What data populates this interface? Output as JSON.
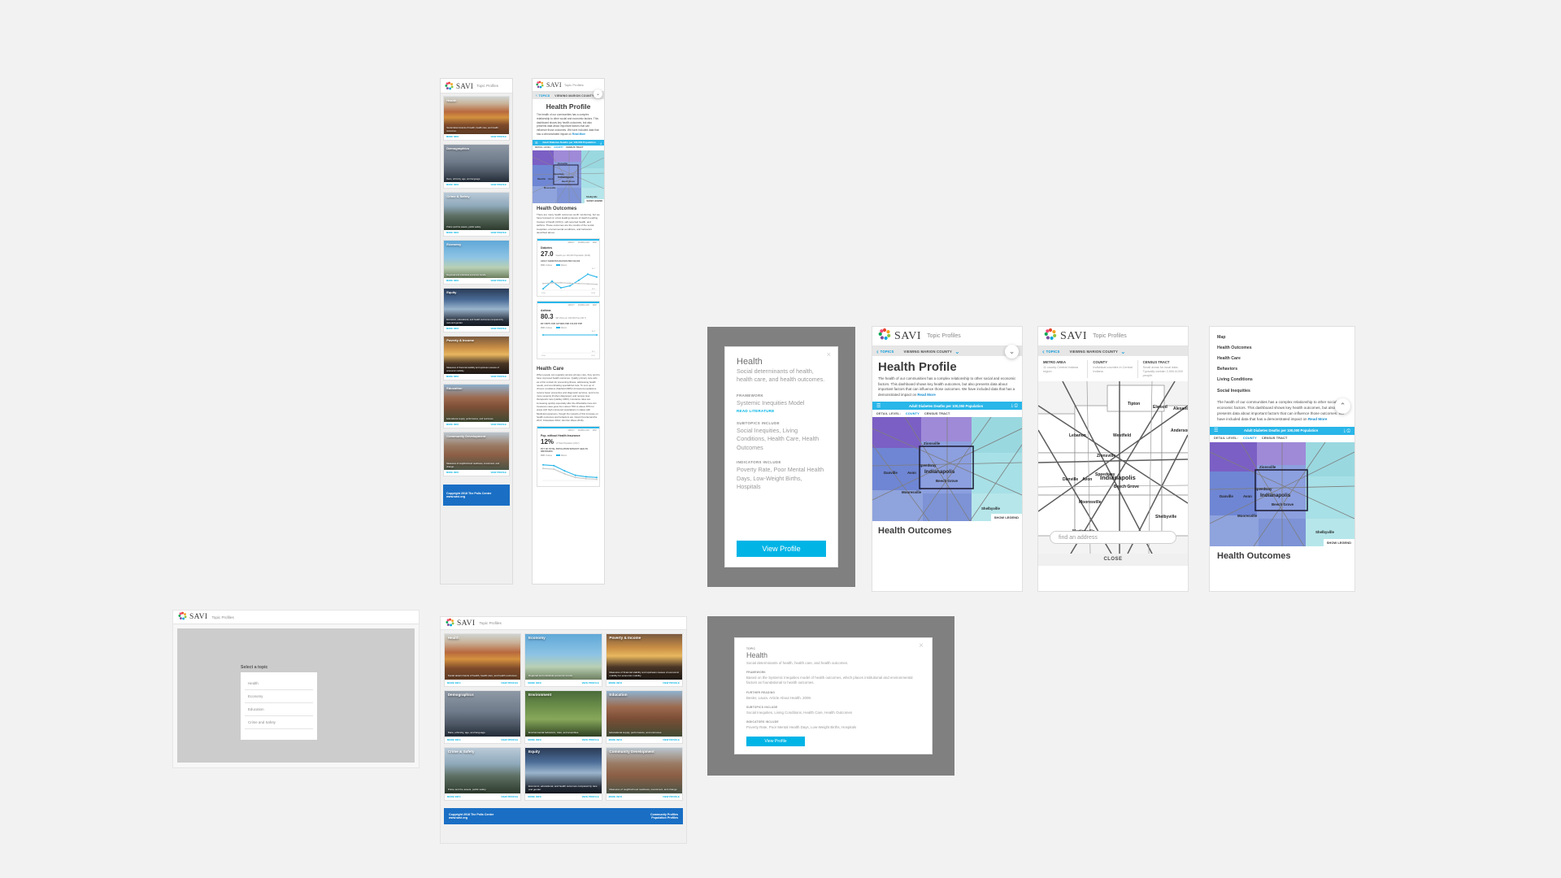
{
  "brand": {
    "name": "SAVI",
    "subtitle": "Topic Profiles"
  },
  "topics": [
    {
      "id": "health",
      "title": "Health",
      "desc": "Social determinants of health, health care, and health outcomes.",
      "photo": "ph-health"
    },
    {
      "id": "economy",
      "title": "Economy",
      "desc": "Regional and individual economic trends.",
      "photo": "ph-econ"
    },
    {
      "id": "poverty",
      "title": "Poverty & Income",
      "desc": "Measures of financial stability and upstream causes of economic mobility for economic mobility.",
      "photo": "ph-poverty"
    },
    {
      "id": "demographics",
      "title": "Demographics",
      "desc": "Race, ethnicity, age, and language.",
      "photo": "ph-demog"
    },
    {
      "id": "environment",
      "title": "Environment",
      "desc": "Environmental behaviors, risks, and amenities.",
      "photo": "ph-env"
    },
    {
      "id": "education",
      "title": "Education",
      "desc": "Educational supply, performance, and outcomes.",
      "photo": "ph-education"
    },
    {
      "id": "crime",
      "title": "Crime & Safety",
      "desc": "Police and fire assets, public safety.",
      "photo": "ph-crime"
    },
    {
      "id": "equity",
      "title": "Equity",
      "desc": "Economic, educational, and health outcomes compared by race and gender.",
      "photo": "ph-equity"
    },
    {
      "id": "commdev",
      "title": "Community Development",
      "desc": "Measures of neighborhood readiness, investment, and change.",
      "photo": "ph-commdev"
    }
  ],
  "mobile_topics": [
    {
      "title": "Health",
      "desc": "Social determinants of health, health care, and health outcomes.",
      "photo": "ph-health"
    },
    {
      "title": "Demographics",
      "desc": "Race, ethnicity, age, and language.",
      "photo": "ph-demog"
    },
    {
      "title": "Crime & Safety",
      "desc": "Police and fire assets, public safety.",
      "photo": "ph-crime"
    },
    {
      "title": "Economy",
      "desc": "Regional and individual economic trends.",
      "photo": "ph-econ"
    },
    {
      "title": "Equity",
      "desc": "Economic, educational, and health outcomes compared by race and gender.",
      "photo": "ph-equity"
    },
    {
      "title": "Poverty & Income",
      "desc": "Measures of financial stability and upstream causes of economic mobility.",
      "photo": "ph-poverty"
    },
    {
      "title": "Education",
      "desc": "Educational supply, performance, and outcomes.",
      "photo": "ph-education"
    },
    {
      "title": "Community Development",
      "desc": "Measures of neighborhood readiness, investment, and change.",
      "photo": "ph-commdev"
    }
  ],
  "card_actions": {
    "more_info": "MORE INFO",
    "view_profile": "VIEW PROFILE"
  },
  "footer": {
    "copyright": "Copyright 2018 The Polis Center",
    "url": "www.savi.org",
    "link_a": "Community Profiles",
    "link_b": "Population Profiles"
  },
  "select_topic": {
    "heading": "Select a topic",
    "options": [
      "Health",
      "Economy",
      "Education",
      "Crime and Safety"
    ]
  },
  "modal_tablet": {
    "title": "Health",
    "desc": "Social determinants of health, health care, and health outcomes.",
    "framework_label": "FRAMEWORK",
    "framework_value": "Systemic Inequities Model",
    "read_literature": "READ LITERATURE",
    "subtopics_label": "SUBTOPICS INCLUDE",
    "subtopics_value": "Social Inequities, Living Conditions, Health Care, Health Outcomes",
    "indicators_label": "INDICATORS INCLUDE",
    "indicators_value": "Poverty Rate, Poor Mental Health Days, Low-Weight Births, Hospitals",
    "button": "View Profile",
    "close": "×"
  },
  "modal_desktop": {
    "topic_label": "TOPIC",
    "title": "Health",
    "desc": "Social determinants of health, health care, and health outcomes.",
    "framework_label": "FRAMEWORK",
    "framework_value": "Based on the Systemic Inequities model of health outcomes, which places institutional and environmental factors as foundational to health outcomes.",
    "reading_label": "FURTHER READING",
    "reading_value": "Besler, Laura. Article About Health. 2009.",
    "subtopics_label": "SUBTOPICS INCLUDE",
    "subtopics_value": "Social Inequities, Living Conditions, Health Care, Health Outcomes",
    "indicators_label": "INDICATORS INCLUDE",
    "indicators_value": "Poverty Rate, Poor Mental Health Days, Low-Weight Births, Hospitals",
    "button": "View Profile",
    "close": "×"
  },
  "profile": {
    "back": "TOPICS",
    "viewing": "VIEWING MARION COUNTY",
    "title": "Health Profile",
    "intro": "The health of our communities has a complex relationship to other social and economic factors. This dashboard shows key health outcomes, but also presents data about important factors that can influence those outcomes. We have included data that has a demonstrated impact on",
    "read_more": "Read More",
    "map_title": "Adult Diabetes Deaths per 100,000 Population",
    "detail_label": "DETAIL LEVEL:",
    "detail_county": "COUNTY",
    "detail_tract": "CENSUS TRACT",
    "show_legend": "SHOW LEGEND",
    "section_outcomes": "Health Outcomes",
    "outcomes_body": "There are many health outcomes worth monitoring, but we have focused on a few leading causes of death (Leading Causes of Death (CDC)), self-reported health, and asthma. These outcomes are the results of the social inequities, environmental conditions, and behaviors described above.",
    "section_care": "Health Care",
    "care_body": "When people can regularly access primary care, they tend to have improved health outcomes. Quality primary care acts as a first contact for preventing illness, addressing health needs, and coordinating specialized care. To sum up of chronic conditions (Starfield 2005) Uninsured populations receive fewer preventive and diagnostic services, tend to be more severely ill when diagnosed, and receive less therapeutic care (Hadley 2003). Insurance rates are increasing quickly especially after the Affordable Care Act. Insurance rates grew from about 79% to above 87% for areas with high uninsured populations in states with Medicaid expansion, though the impacts of this increase on health outcomes and behaviors are mixed (Courtemanche 2017; Finkelstein 2012; Van Der Wees 2016)."
  },
  "nav_sections": [
    "Map",
    "Health Outcomes",
    "Health Care",
    "Behaviors",
    "Living Conditions",
    "Social Inequities"
  ],
  "detail_levels": [
    {
      "name": "METRO AREA",
      "desc": "11 county Central Indiana region"
    },
    {
      "name": "COUNTY",
      "desc": "Individual counties in Central Indiana"
    },
    {
      "name": "CENSUS TRACT",
      "desc": "Small areas for local data. Typically contain 2,500-8,000 people."
    }
  ],
  "address_search": {
    "placeholder": "find an address",
    "close": "CLOSE"
  },
  "indicator_tabs": [
    "ABOUT",
    "DOWNLOAD",
    "MAP"
  ],
  "chart_data": [
    {
      "type": "line",
      "id": "diabetes",
      "title": "Diabetes",
      "value": "27.0",
      "unit": "Deaths per 100,000 Population (2016)",
      "caption": "ADULT DIABETES DEATHS PER 100,000",
      "legend": [
        "Indiana",
        "Marion"
      ],
      "x": [
        "2010",
        "2011",
        "2012",
        "2013",
        "2014",
        "2015",
        "2016"
      ],
      "ylim": [
        18.1,
        33.7
      ],
      "ytick_top": "33.7",
      "ytick_bottom": "18.1",
      "xtick_left": "2010",
      "xtick_right": "2016",
      "series": [
        {
          "name": "Marion",
          "color": "#29b6e8",
          "values": [
            19.4,
            26.0,
            20.2,
            21.9,
            26.8,
            32.1,
            29.6
          ]
        },
        {
          "name": "Indiana",
          "color": "#c9c9c9",
          "values": [
            24.0,
            24.4,
            24.6,
            24.2,
            23.9,
            23.6,
            23.3
          ]
        }
      ]
    },
    {
      "type": "line",
      "id": "asthma",
      "title": "Asthma",
      "value": "80.3",
      "unit": "ER Visits per 100,000 Pop (2017)",
      "caption": "ER VISITS FOR ASTHMA PER 100,000 POP",
      "legend": [
        "Indiana",
        "Marion"
      ],
      "x": [
        "2016",
        "2017"
      ],
      "ylim": [
        33.1,
        80.3
      ],
      "ytick_top": "80.3",
      "ytick_bottom": "33.1",
      "xtick_left": "2016",
      "xtick_right": "2017",
      "series": [
        {
          "name": "Marion",
          "color": "#29b6e8",
          "values": [
            80.3,
            80.3
          ]
        }
      ]
    },
    {
      "type": "line",
      "id": "uninsured",
      "title": "Pop. without Health Insurance",
      "value": "12%",
      "unit": "of Total Population (2017)",
      "caption": "PCT OF TOTAL POPULATION WITHOUT HEALTH INSURANCE",
      "legend": [
        "Indiana",
        "Marion"
      ],
      "x": [
        "2012",
        "2013",
        "2014",
        "2015",
        "2016",
        "2017"
      ],
      "ylim": [
        10,
        22
      ],
      "series": [
        {
          "name": "Marion",
          "color": "#29b6e8",
          "values": [
            20.5,
            20.0,
            16.5,
            13.5,
            12.5,
            12.0
          ]
        },
        {
          "name": "Indiana",
          "color": "#c9c9c9",
          "values": [
            18.0,
            17.6,
            14.5,
            12.0,
            11.2,
            10.8
          ]
        }
      ]
    }
  ],
  "map_labels": {
    "small": [
      "Zionsville",
      "Speedway",
      "Danville",
      "Avon",
      "Indianapolis",
      "Beech Grove",
      "Mooresville",
      "Shelbyville"
    ],
    "large": [
      "Tipton",
      "Elwood",
      "Alexandria",
      "Anderson",
      "Lebanon",
      "Westfield",
      "Zionsville",
      "Speedway",
      "Danville",
      "Avon",
      "Indianapolis",
      "Beech Grove",
      "Mooresville",
      "Shelbyville",
      "Martinsville"
    ]
  }
}
